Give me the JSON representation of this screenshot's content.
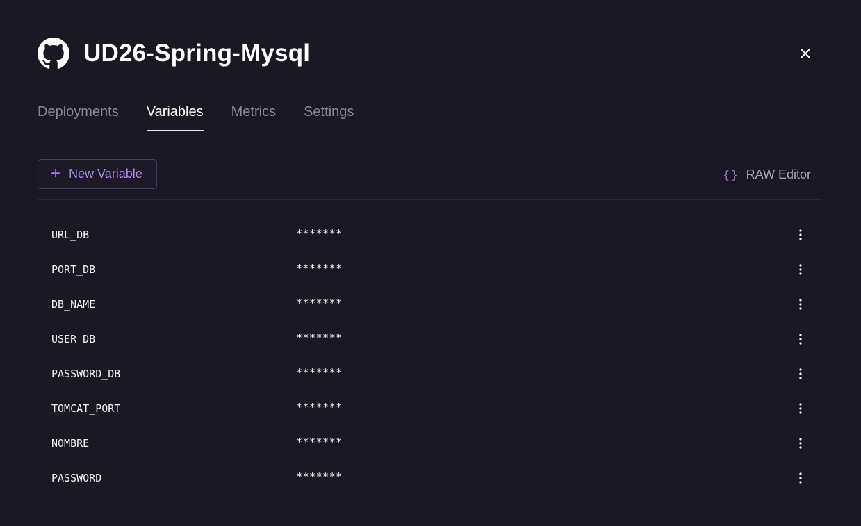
{
  "service": {
    "title": "UD26-Spring-Mysql",
    "icon": "github-icon"
  },
  "tabs": [
    {
      "label": "Deployments",
      "active": false
    },
    {
      "label": "Variables",
      "active": true
    },
    {
      "label": "Metrics",
      "active": false
    },
    {
      "label": "Settings",
      "active": false
    }
  ],
  "toolbar": {
    "new_variable_label": "New Variable",
    "new_variable_icon": "plus-icon",
    "raw_editor_label": "RAW Editor",
    "raw_editor_icon": "braces-icon",
    "raw_editor_glyph": "{}"
  },
  "variables": [
    {
      "name": "URL_DB",
      "value": "*******"
    },
    {
      "name": "PORT_DB",
      "value": "*******"
    },
    {
      "name": "DB_NAME",
      "value": "*******"
    },
    {
      "name": "USER_DB",
      "value": "*******"
    },
    {
      "name": "PASSWORD_DB",
      "value": "*******"
    },
    {
      "name": "TOMCAT_PORT",
      "value": "*******"
    },
    {
      "name": "NOMBRE",
      "value": "*******"
    },
    {
      "name": "PASSWORD",
      "value": "*******"
    }
  ],
  "colors": {
    "background": "#1a1823",
    "accent": "#b58cf0",
    "muted": "#8a8797"
  }
}
